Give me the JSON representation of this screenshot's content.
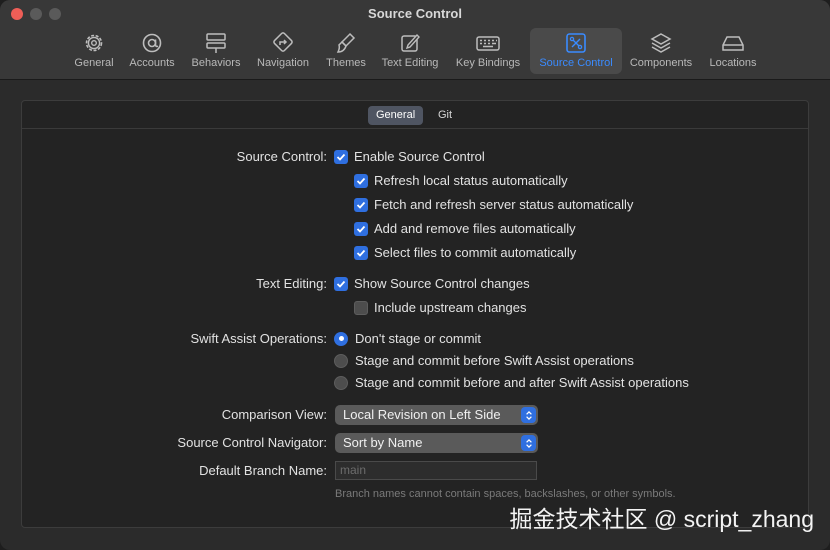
{
  "window": {
    "title": "Source Control"
  },
  "toolbar": {
    "tabs": [
      {
        "label": "General",
        "icon": "gear-icon"
      },
      {
        "label": "Accounts",
        "icon": "at-icon"
      },
      {
        "label": "Behaviors",
        "icon": "behaviors-icon"
      },
      {
        "label": "Navigation",
        "icon": "navigation-icon"
      },
      {
        "label": "Themes",
        "icon": "brush-icon"
      },
      {
        "label": "Text Editing",
        "icon": "pencil-square-icon"
      },
      {
        "label": "Key Bindings",
        "icon": "keyboard-icon"
      },
      {
        "label": "Source Control",
        "icon": "source-control-icon",
        "active": true
      },
      {
        "label": "Components",
        "icon": "layers-icon"
      },
      {
        "label": "Locations",
        "icon": "drive-icon"
      }
    ]
  },
  "segments": {
    "general": "General",
    "git": "Git",
    "selected": "General"
  },
  "source_control": {
    "label": "Source Control:",
    "enable": {
      "label": "Enable Source Control",
      "checked": true
    },
    "refresh_local": {
      "label": "Refresh local status automatically",
      "checked": true
    },
    "fetch_server": {
      "label": "Fetch and refresh server status automatically",
      "checked": true
    },
    "add_remove": {
      "label": "Add and remove files automatically",
      "checked": true
    },
    "select_files": {
      "label": "Select files to commit automatically",
      "checked": true
    }
  },
  "text_editing": {
    "label": "Text Editing:",
    "show_changes": {
      "label": "Show Source Control changes",
      "checked": true
    },
    "include_upstream": {
      "label": "Include upstream changes",
      "checked": false
    }
  },
  "swift_assist": {
    "label": "Swift Assist Operations:",
    "options": [
      {
        "label": "Don't stage or commit",
        "selected": true
      },
      {
        "label": "Stage and commit before Swift Assist operations",
        "selected": false
      },
      {
        "label": "Stage and commit before and after Swift Assist operations",
        "selected": false
      }
    ]
  },
  "comparison_view": {
    "label": "Comparison View:",
    "value": "Local Revision on Left Side"
  },
  "navigator": {
    "label": "Source Control Navigator:",
    "value": "Sort by Name"
  },
  "default_branch": {
    "label": "Default Branch Name:",
    "placeholder": "main",
    "hint": "Branch names cannot contain spaces, backslashes, or other symbols."
  },
  "watermark": "掘金技术社区 @ script_zhang",
  "colors": {
    "accent": "#2f6fe0",
    "active_tab_text": "#3a8bff",
    "close_button": "#ee5e57"
  }
}
